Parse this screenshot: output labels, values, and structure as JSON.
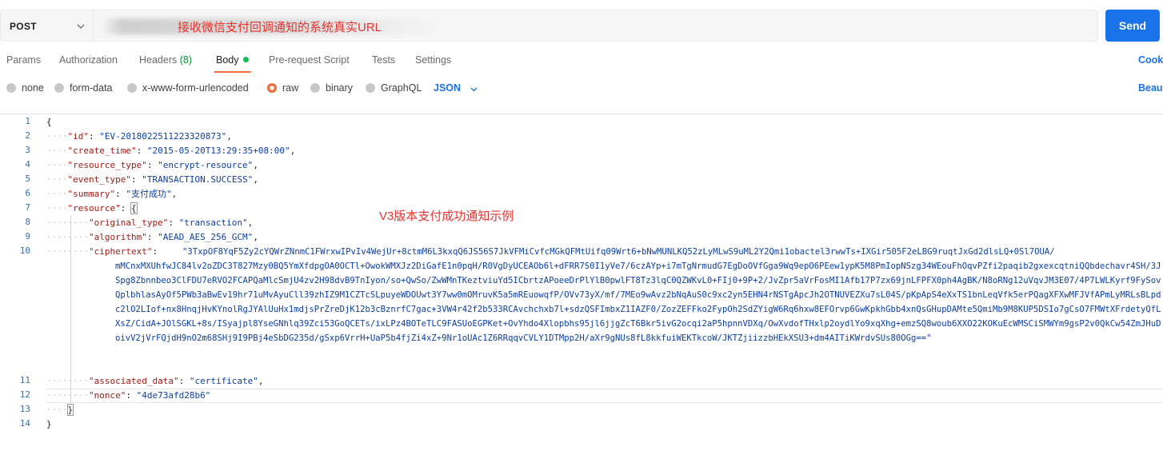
{
  "request": {
    "method": "POST",
    "url_annotation": "接收微信支付回调通知的系统真实URL",
    "send_label": "Send"
  },
  "tabs": {
    "params": "Params",
    "authorization": "Authorization",
    "headers": "Headers",
    "headers_count": "(8)",
    "body": "Body",
    "pre_request": "Pre-request Script",
    "tests": "Tests",
    "settings": "Settings",
    "cookies": "Cook"
  },
  "body_options": {
    "none": "none",
    "form_data": "form-data",
    "urlencoded": "x-www-form-urlencoded",
    "raw": "raw",
    "binary": "binary",
    "graphql": "GraphQL",
    "format": "JSON",
    "beautify": "Beau"
  },
  "editor": {
    "annotation": "V3版本支付成功通知示例",
    "line_numbers": [
      "1",
      "2",
      "3",
      "4",
      "5",
      "6",
      "7",
      "8",
      "9",
      "10",
      "11",
      "12",
      "13",
      "14"
    ],
    "l1": "{",
    "l2_key": "\"id\"",
    "l2_val": "\"EV-2018022511223320873\"",
    "l3_key": "\"create_time\"",
    "l3_val": "\"2015-05-20T13:29:35+08:00\"",
    "l4_key": "\"resource_type\"",
    "l4_val": "\"encrypt-resource\"",
    "l5_key": "\"event_type\"",
    "l5_val": "\"TRANSACTION.SUCCESS\"",
    "l6_key": "\"summary\"",
    "l6_val": "\"支付成功\"",
    "l7_key": "\"resource\"",
    "l7_brace": "{",
    "l8_key": "\"original_type\"",
    "l8_val": "\"transaction\"",
    "l9_key": "\"algorithm\"",
    "l9_val": "\"AEAD_AES_256_GCM\"",
    "l10_key": "\"ciphertext\"",
    "l10_first": "\"3TxpOF8YqF5Zy2cYQWrZNnmC1FWrxwIPvIv4WejUr+8ctmM6L3kxqQ6JS56S7JkVFMiCvfcMGkQFMtUifq09Wrt6+bNwMUNLKQ52zLyMLwS9uML2Y2Qmi1obactel3rwwTs+IXGir505F2eLBG9ruqtJxGd2dlsLQ+0Sl7OUA/",
    "l10_rest": "mMCnxMXUhfwJC84lv2oZDC3T827Mzy0BQ5YmXfdpgOA0OCTl+OwokWMXJz2DiGafE1n0pqH/R0VgDyUCEAOb6l+dFRR7S0I1yVe7/6czAYp+i7mTgNrmudG7EgDoOVfGga9Wq9epO6PEew1ypK5M8PmIopNSzg34WEouFhOqvPZfi2paqib2gxexcqtniQQbdechavr4SH/3JSpg8Zbnnbeo3ClFDU7eRVO2FCAPQaMlcSmjU4zv2H98dvB9TnIyon/so+QwSo/ZwWMnTKeztviuYd5ICbrtzAPoeeDrPlYlB0pwlFT8Tz3lqC0QZWKvL0+FIj0+9P+2/JvZpr5aVrFosMI1Afb17P7zx69jnLFPFX0ph4AgBK/N8oRNg12uVqvJM3E07/4P7LWLKyrf9FySovQplbhlasAyOf5PWb3aBwEv19hr71uMvAyuCll39zhIZ9M1CZTcSLpuyeWDOUwt3Y7ww0mOMruvK5a5mREuowqfP/OVv73yX/mf/7MEo9wAvz2bNqAuS0c9xc2yn5EHN4rNSTgApcJh2OTNUVEZXu7sL04S/pKpApS4eXxTS1bnLeqVfk5erPQagXFXwMFJVfAPmLyMRLsBLpdc2lO2LIof+nx8HnqjHvKYnolRgJYAlUuHx1mdjsPrZreDjK12b3cBznrfC7gac+3VW4r42f2b533RCAvchchxb7l+sdzQSFImbxZ1IAZF0/ZozZEFFko2FypOh2SdZYigW6Rq6hxw8EFOrvp6GwKpkhGbb4xnQsGHupDAMte5QmiMb9M8KUP5DSIo7gCsO7FMWtXFrdetyQfLXsZ/CidA+JOlSGKL+8s/ISyajpl8YseGNhlq39Zci53GoQCETs/ixLPz4BOTeTLC9FASUoEGPKet+OvYhdo4Xlopbhs95jl6jjgZcT6Bkr5ivG2ocqi2aP5hpnnVDXq/OwXvdofTHxlp2oydlYo9xqXhg+emzSQ8woub6XXO22KOKuEcWMSCiSMWYm9gsP2v0QkCw54ZmJHuDoivV2jVrFQjdH9nO2m68SHj9I9PBj4eSbDG235d/gSxp6VrrH+UaP5b4fjZi4xZ+9Nr1oUAc1Z6RRqqvCVLY1DTMpp2H/aXr9gNUs8fL8kkfuiWEKTkcoW/JKTZjiizzbHEkXSU3+dm4AITiKWrdvSUs80OGg==\"",
    "l11_key": "\"associated_data\"",
    "l11_val": "\"certificate\"",
    "l12_key": "\"nonce\"",
    "l12_val": "\"4de73afd28b6\"",
    "l13": "}",
    "l14": "}"
  }
}
